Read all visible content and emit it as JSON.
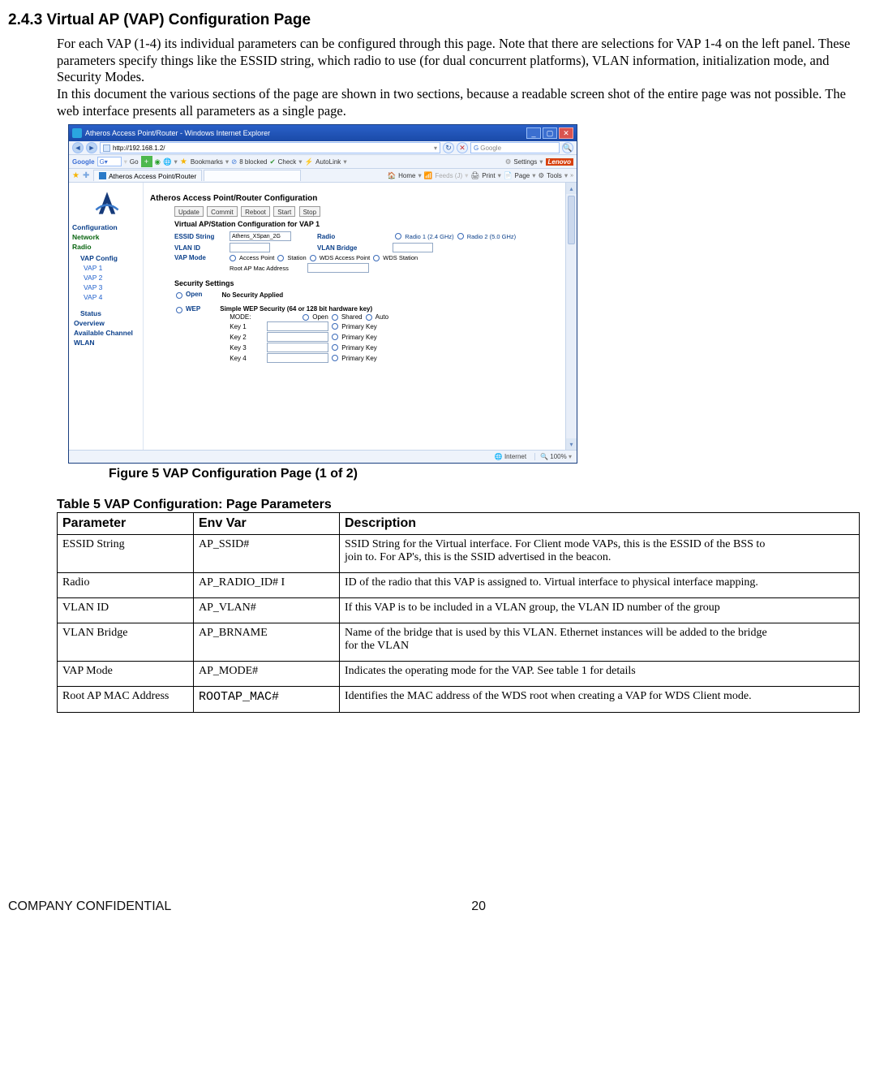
{
  "heading": "2.4.3 Virtual AP (VAP) Configuration Page",
  "para1": "For each VAP (1-4) its individual parameters can be configured through this page. Note that there are selections for VAP 1-4 on the left panel. These parameters specify things like the ESSID string, which radio to use (for dual concurrent platforms), VLAN information, initialization mode, and Security Modes.",
  "para2": "In this document the various sections of the page are shown in two sections, because a readable screen shot of the entire page was not possible. The web interface presents all parameters as a single page.",
  "browser": {
    "window_title": "Atheros Access Point/Router - Windows Internet Explorer",
    "url": "http://192.168.1.2/",
    "search_placeholder": "Google",
    "google_toolbar": {
      "go": "Go",
      "bookmarks": "Bookmarks",
      "blocked": "8 blocked",
      "check": "Check",
      "autolink": "AutoLink",
      "settings": "Settings",
      "brand": "Lenovo"
    },
    "tab_title": "Atheros Access Point/Router",
    "ie_toolbar": {
      "home": "Home",
      "feeds": "Feeds (J)",
      "print": "Print",
      "page": "Page",
      "tools": "Tools"
    },
    "page_title": "Atheros Access Point/Router Configuration",
    "nav": {
      "configuration": "Configuration",
      "network": "Network",
      "radio": "Radio",
      "vap_config": "VAP Config",
      "vap1": "VAP 1",
      "vap2": "VAP 2",
      "vap3": "VAP 3",
      "vap4": "VAP 4",
      "status": "Status",
      "overview": "Overview",
      "available_channel": "Available Channel",
      "wlan": "WLAN"
    },
    "buttons": {
      "update": "Update",
      "commit": "Commit",
      "reboot": "Reboot",
      "start": "Start",
      "stop": "Stop"
    },
    "form_title": "Virtual AP/Station Configuration for VAP 1",
    "labels": {
      "essid": "ESSID String",
      "essid_val": "Athens_XSpan_2G",
      "radio": "Radio",
      "radio1": "Radio 1 (2.4 GHz)",
      "radio2": "Radio 2 (5.0 GHz)",
      "vlanid": "VLAN ID",
      "vlanbridge": "VLAN Bridge",
      "vapmode": "VAP Mode",
      "mode_ap": "Access Point",
      "mode_sta": "Station",
      "mode_wdsap": "WDS Access Point",
      "mode_wdssta": "WDS Station",
      "rootap": "Root AP Mac Address"
    },
    "security": {
      "title": "Security Settings",
      "open": "Open",
      "open_body": "No Security Applied",
      "wep": "WEP",
      "wep_title": "Simple WEP Security (64 or 128 bit hardware key)",
      "mode": "MODE:",
      "mode_open": "Open",
      "mode_shared": "Shared",
      "mode_auto": "Auto",
      "key1": "Key 1",
      "key2": "Key 2",
      "key3": "Key 3",
      "key4": "Key 4",
      "primary": "Primary Key"
    },
    "status_bar": {
      "zone": "Internet",
      "zoom": "100%"
    }
  },
  "figcaption": "Figure 5 VAP Configuration Page (1 of 2)",
  "tablecaption": "Table 5 VAP Configuration: Page Parameters",
  "table": {
    "headers": {
      "param": "Parameter",
      "env": "Env Var",
      "desc": "Description"
    },
    "rows": [
      {
        "param": "ESSID String",
        "env": "AP_SSID#",
        "desc": "SSID String for the Virtual interface. For Client mode VAPs, this is the ESSID of the BSS to\njoin to. For AP's, this is the SSID advertised in the beacon."
      },
      {
        "param": "Radio",
        "env": "AP_RADIO_ID# I",
        "desc": "ID of the radio that this VAP is assigned to. Virtual interface to physical interface mapping."
      },
      {
        "param": "VLAN ID",
        "env": "AP_VLAN#",
        "desc": "If this VAP is to be included in a VLAN group, the VLAN ID number of the group"
      },
      {
        "param": "VLAN Bridge",
        "env": "AP_BRNAME",
        "desc": "Name of the bridge that is used by this VLAN. Ethernet instances will be added to the bridge\nfor the VLAN"
      },
      {
        "param": "VAP Mode",
        "env": "AP_MODE#",
        "desc": "Indicates the operating mode for the VAP. See table 1 for details"
      },
      {
        "param": "Root AP MAC Address",
        "env": "ROOTAP_MAC#",
        "mono": true,
        "desc": "Identifies the MAC address of the WDS root when creating a VAP for WDS Client mode."
      }
    ]
  },
  "footer": {
    "confidential": "COMPANY CONFIDENTIAL",
    "page": "20"
  }
}
